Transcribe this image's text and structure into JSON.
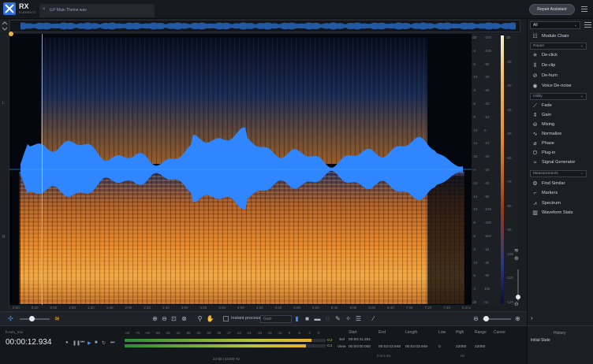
{
  "app": {
    "name": "RX",
    "edition": "ELEMENTS"
  },
  "file_tab": {
    "name": "ILP Main Theme.wav",
    "close": "×"
  },
  "header": {
    "repair_assistant": "Repair Assistant"
  },
  "overview": {},
  "left_ruler": [
    "L",
    "R"
  ],
  "time_ruler": [
    "0:00",
    "0:20",
    "0:40",
    "1:00",
    "1:20",
    "1:40",
    "2:00",
    "2:20",
    "2:40",
    "3:00",
    "3:20",
    "3:40",
    "4:00",
    "4:20",
    "4:40",
    "5:00",
    "5:20",
    "5:40",
    "6:00",
    "6:20",
    "6:40",
    "7:00",
    "7:20",
    "7:40",
    "h:m:s"
  ],
  "amp_ruler": [
    "dB",
    "-4",
    "-6",
    "-10",
    "-3",
    "-6",
    "-8",
    "-10",
    "-14",
    "-22",
    "-∞",
    "-22",
    "-14",
    "-10",
    "-8",
    "-6",
    "-3",
    "-10",
    "-6",
    "-4",
    "dB"
  ],
  "hz_ruler": [
    "-200",
    "-100",
    "-50",
    "-40",
    "-30",
    "-20",
    "-10",
    "0",
    "-10",
    "-20",
    "-30",
    "-40",
    "-50",
    "-100",
    "-200",
    "-500",
    "-1k",
    "-2k",
    "-5k",
    "10k",
    "Hz"
  ],
  "db_ruler": [
    "dB",
    "-20",
    "-30",
    "-40",
    "-50",
    "-60",
    "-70",
    "-80",
    "-90",
    "-100",
    "-110",
    "-120"
  ],
  "toolbar": {
    "instant_process": "Instant process",
    "gain_placeholder": "Gain"
  },
  "transport": {
    "filename": "ft.mrx_mix",
    "timecode": "00:00:12.934",
    "meter_scale": [
      "-Inf.",
      "-70",
      "-60",
      "-50",
      "-45",
      "-42",
      "-39",
      "-36",
      "-33",
      "-30",
      "-27",
      "-24",
      "-21",
      "-18",
      "-15",
      "-12",
      "-9",
      "-6",
      "-3",
      "0"
    ],
    "meter_peak_l": "-0.2",
    "meter_peak_r": "-0.2",
    "meter_fill_l": 0.93,
    "meter_fill_r": 0.9,
    "bit_info": "24-bit | 44100 Hz"
  },
  "selection": {
    "headers": {
      "start": "Start",
      "end": "End",
      "length": "Length",
      "low": "Low",
      "high": "High",
      "range": "Range",
      "cursor": "Cursor"
    },
    "sel_label": "Sel",
    "view_label": "View",
    "sel_start": "00:00:41.251",
    "view_start": "00:00:00.000",
    "view_end": "00:02:03.949",
    "view_length": "00:02:03.949",
    "low": "0",
    "high": "22050",
    "range": "22050",
    "time_unit": "h:m:s.ms",
    "hz_unit": "Hz"
  },
  "panel": {
    "filter": "All",
    "module_chain": "Module Chain",
    "repair_section": "Repair",
    "repair_items": [
      "De-click",
      "De-clip",
      "De-hum",
      "Voice De-noise"
    ],
    "utility_section": "Utility",
    "utility_items": [
      "Fade",
      "Gain",
      "Mixing",
      "Normalize",
      "Phase",
      "Plug-in",
      "Signal Generator"
    ],
    "measurements_section": "Measurements",
    "measurement_items": [
      "Find Similar",
      "Markers",
      "Spectrum",
      "Waveform Stats"
    ]
  },
  "history": {
    "title": "History",
    "state": "Initial State"
  }
}
